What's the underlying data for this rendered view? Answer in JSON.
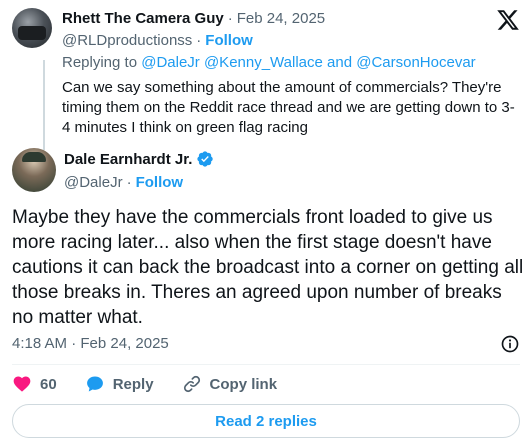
{
  "parent_tweet": {
    "display_name": "Rhett The Camera Guy",
    "date": "Feb 24, 2025",
    "handle": "@RLDproductionss",
    "follow_label": "Follow",
    "replying_prefix": "Replying to",
    "replying_mentions": "@DaleJr @Kenny_Wallace and @CarsonHocevar",
    "text": "Can we say something about the amount of commercials? They're timing them on the Reddit race thread and we are getting down to 3-4 minutes I think on green flag racing"
  },
  "main_tweet": {
    "display_name": "Dale Earnhardt Jr.",
    "handle": "@DaleJr",
    "follow_label": "Follow",
    "text": "Maybe they have the commercials front loaded to give us more racing later... also when the first stage doesn't have cautions it can back the broadcast into a corner on getting all those breaks in. Theres an agreed upon number of breaks no matter what.",
    "timestamp": "4:18 AM · Feb 24, 2025"
  },
  "actions": {
    "like_count": "60",
    "reply_label": "Reply",
    "copy_link_label": "Copy link"
  },
  "read_replies_label": "Read 2 replies",
  "icons": {
    "logo": "x-logo-icon",
    "verified": "verified-badge-icon",
    "info": "info-icon",
    "like": "heart-icon",
    "reply": "reply-bubble-icon",
    "copy_link": "link-icon"
  },
  "colors": {
    "link_blue": "#1d9bf0",
    "text_primary": "#0f1419",
    "text_muted": "#536471",
    "like_pink": "#f91880"
  }
}
